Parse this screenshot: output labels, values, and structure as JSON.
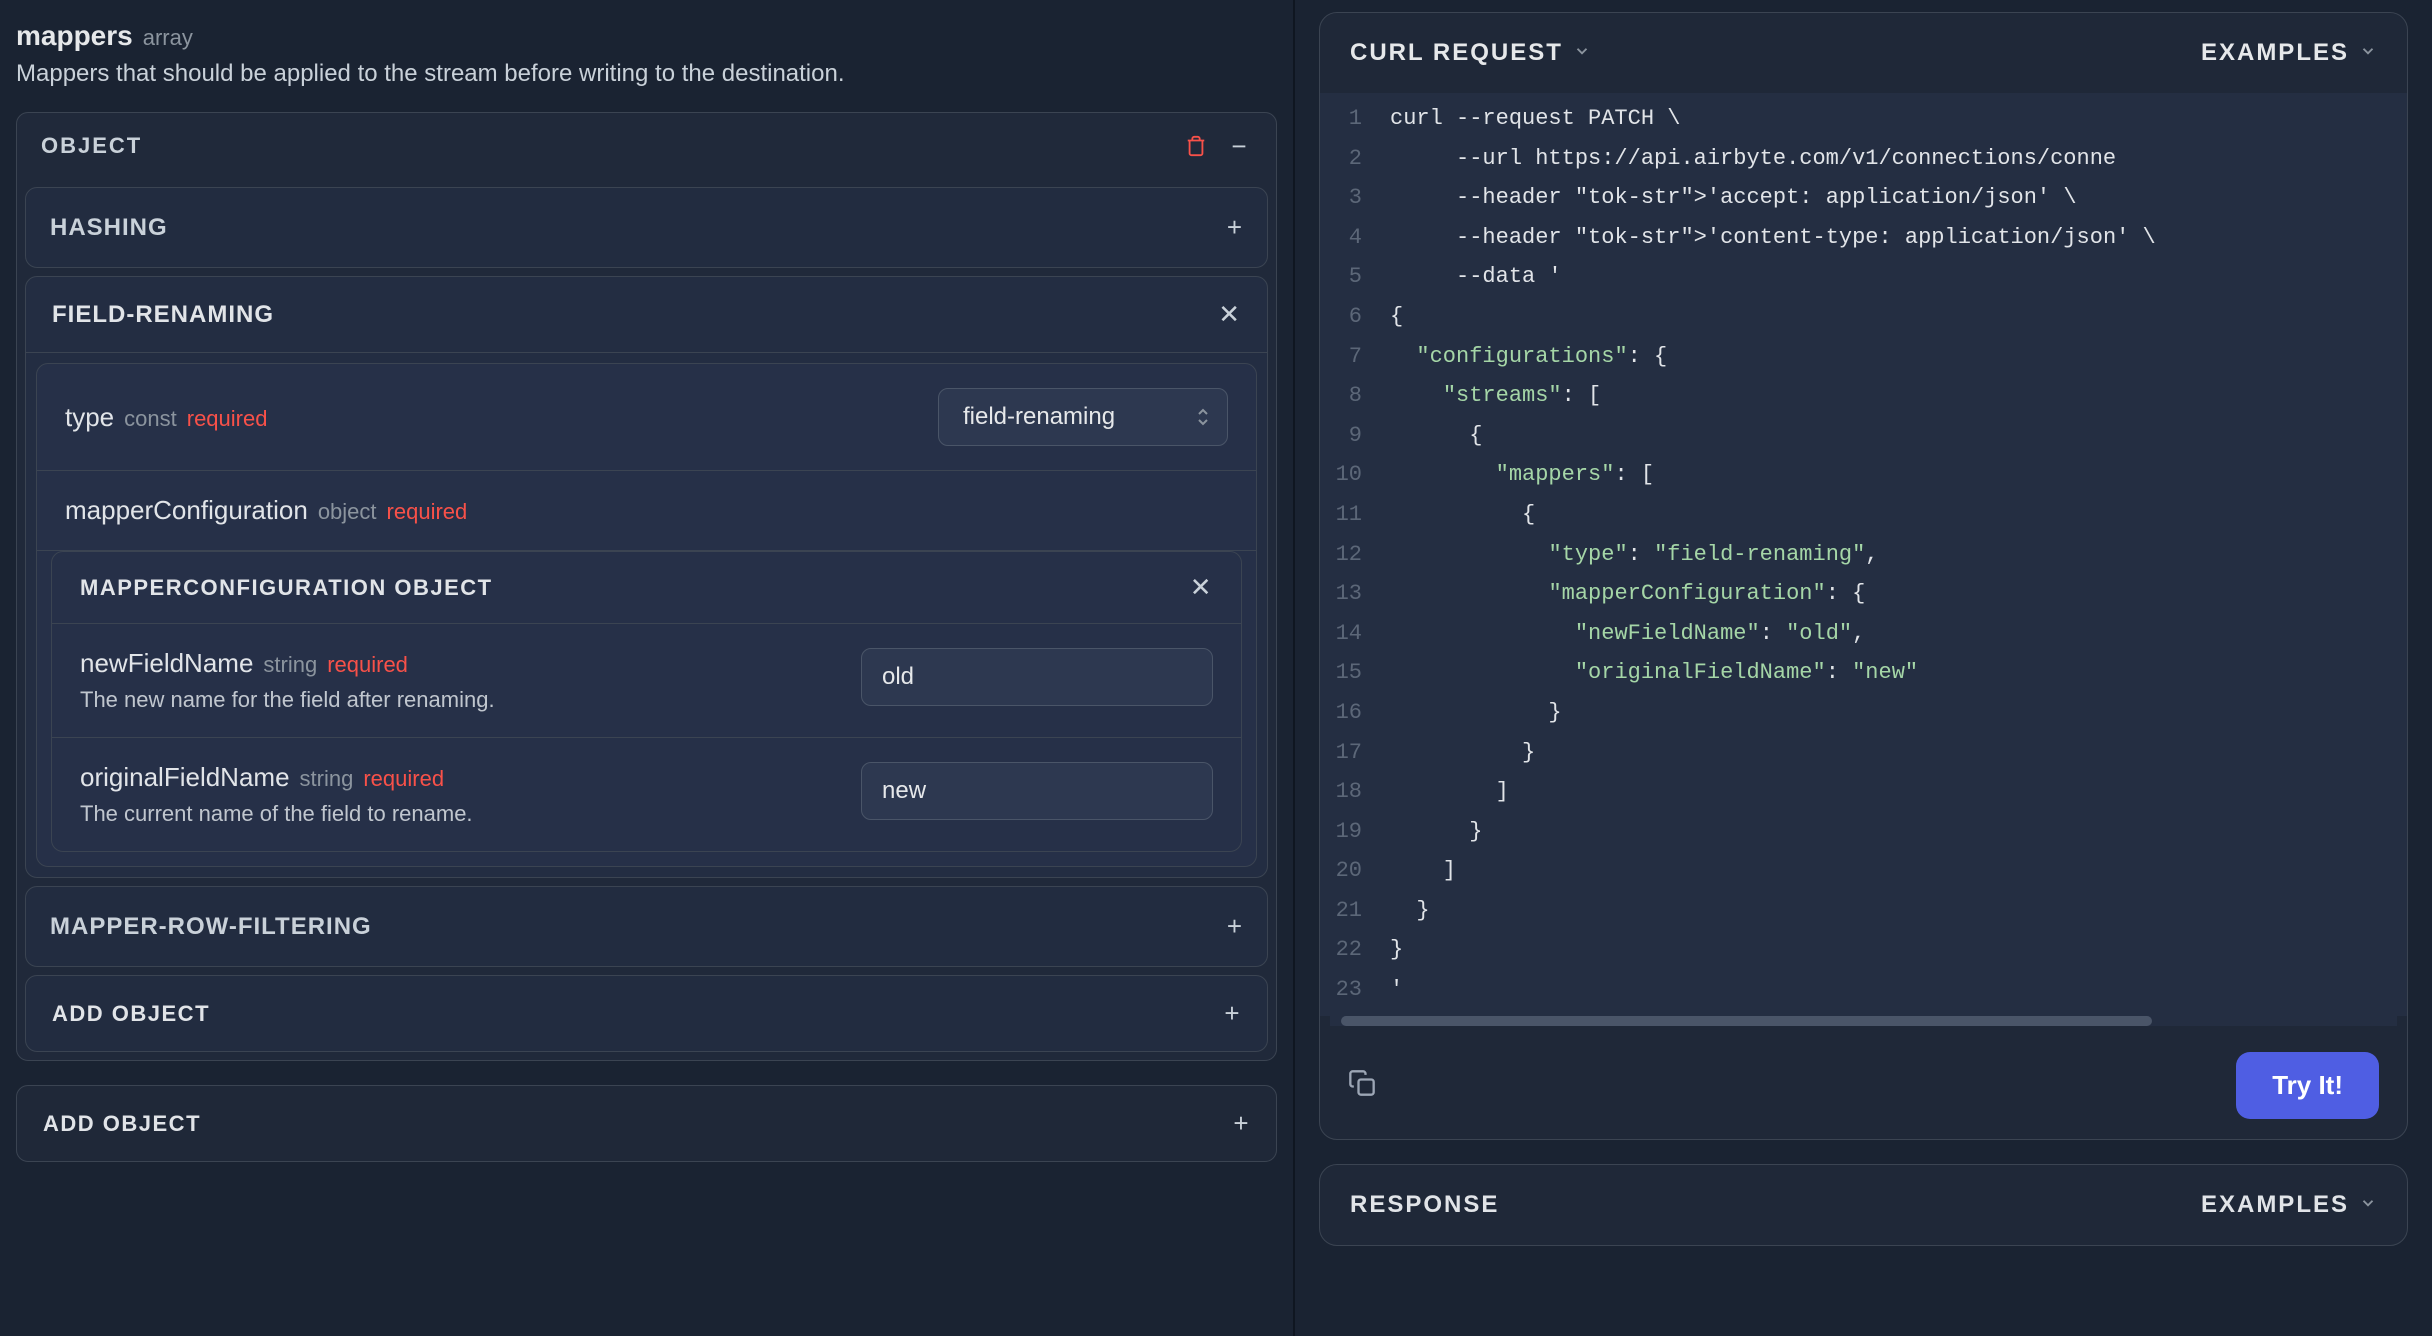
{
  "mappers": {
    "name": "mappers",
    "type": "array",
    "description": "Mappers that should be applied to the stream before writing to the destination."
  },
  "object_label": "OBJECT",
  "sections": {
    "hashing": "HASHING",
    "field_renaming": "FIELD-RENAMING",
    "mapper_row_filtering": "MAPPER-ROW-FILTERING"
  },
  "field_renaming": {
    "type_field": {
      "name": "type",
      "type": "const",
      "required": "required",
      "value": "field-renaming"
    },
    "mapper_config": {
      "name": "mapperConfiguration",
      "type": "object",
      "required": "required"
    },
    "mc_object_label": "MAPPERCONFIGURATION OBJECT",
    "newFieldName": {
      "name": "newFieldName",
      "type": "string",
      "required": "required",
      "desc": "The new name for the field after renaming.",
      "value": "old"
    },
    "originalFieldName": {
      "name": "originalFieldName",
      "type": "string",
      "required": "required",
      "desc": "The current name of the field to rename.",
      "value": "new"
    }
  },
  "add_object": "ADD OBJECT",
  "curl": {
    "title": "CURL REQUEST",
    "examples": "EXAMPLES",
    "try_it": "Try It!",
    "lines": [
      "curl --request PATCH \\",
      "     --url https://api.airbyte.com/v1/connections/conne",
      "     --header 'accept: application/json' \\",
      "     --header 'content-type: application/json' \\",
      "     --data '",
      "{",
      "  \"configurations\": {",
      "    \"streams\": [",
      "      {",
      "        \"mappers\": [",
      "          {",
      "            \"type\": \"field-renaming\",",
      "            \"mapperConfiguration\": {",
      "              \"newFieldName\": \"old\",",
      "              \"originalFieldName\": \"new\"",
      "            }",
      "          }",
      "        ]",
      "      }",
      "    ]",
      "  }",
      "}",
      "'"
    ]
  },
  "response": {
    "title": "RESPONSE",
    "examples": "EXAMPLES"
  }
}
